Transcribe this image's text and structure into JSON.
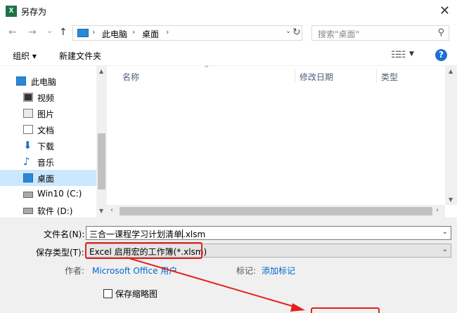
{
  "window": {
    "app_icon": "X",
    "title": "另存为",
    "close_glyph": "✕"
  },
  "navbar": {
    "back": "←",
    "forward": "→",
    "recent": "⌄",
    "up": "↑",
    "address": {
      "sep": "›",
      "segments": [
        "此电脑",
        "桌面"
      ],
      "drop": "⌄",
      "refresh": "↻"
    },
    "search_placeholder": "搜索\"桌面\"",
    "search_glyph": "⚲"
  },
  "toolbar": {
    "organize": "组织 ▾",
    "new_folder": "新建文件夹",
    "view_glyph": "☷☷",
    "view_drop": "▼",
    "help": "?"
  },
  "sidebar": {
    "items": [
      {
        "label": "此电脑",
        "icon": "pc-icon"
      },
      {
        "label": "视频",
        "icon": "video-icon"
      },
      {
        "label": "图片",
        "icon": "pictures-icon"
      },
      {
        "label": "文档",
        "icon": "documents-icon"
      },
      {
        "label": "下载",
        "icon": "download-icon",
        "glyph": "⬇"
      },
      {
        "label": "音乐",
        "icon": "music-icon",
        "glyph": "♪"
      },
      {
        "label": "桌面",
        "icon": "desktop-icon",
        "selected": true
      },
      {
        "label": "Win10 (C:)",
        "icon": "drive-icon"
      },
      {
        "label": "软件 (D:)",
        "icon": "drive-icon"
      }
    ],
    "scroll_up": "▲",
    "scroll_down": "▼"
  },
  "file_list": {
    "columns": [
      "名称",
      "修改日期",
      "类型"
    ],
    "sort_indicator": "^",
    "scroll_up": "▲",
    "scroll_down": "▼",
    "scroll_left": "‹",
    "scroll_right": "›"
  },
  "form": {
    "filename_label": "文件名(N):",
    "filename_before_caret": "三合一课程学习计划清单",
    "filename_after_caret": ".xlsm",
    "filetype_label": "保存类型(T):",
    "filetype_value": "Excel 启用宏的工作簿(*.xlsm)",
    "drop": "⌄",
    "author_label": "作者:",
    "author_value": "Microsoft Office 用户",
    "tags_label": "标记:",
    "tags_value": "添加标记",
    "thumbnail_label": "保存缩略图"
  },
  "colors": {
    "highlight_red": "#e3211c",
    "selection_blue": "#cce8ff",
    "link_blue": "#0066cc",
    "excel_green": "#1e7145"
  }
}
